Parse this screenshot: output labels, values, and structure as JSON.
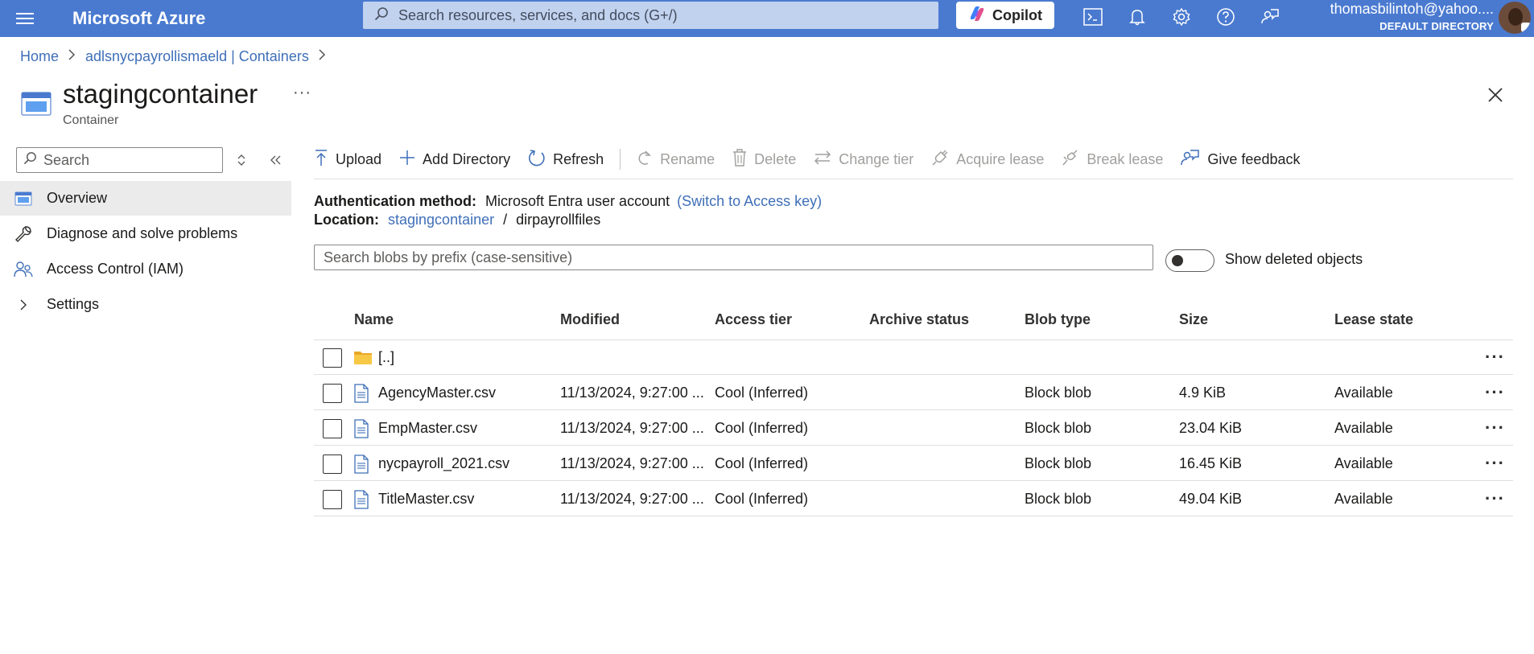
{
  "topbar": {
    "brand": "Microsoft Azure",
    "search_placeholder": "Search resources, services, and docs (G+/)",
    "copilot_label": "Copilot",
    "account_email": "thomasbilintoh@yahoo....",
    "account_directory": "DEFAULT DIRECTORY",
    "accent_color": "#4a7ad0"
  },
  "breadcrumb": {
    "home": "Home",
    "parent": "adlsnycpayrollismaeld | Containers"
  },
  "header": {
    "title": "stagingcontainer",
    "subtitle": "Container",
    "more": "···"
  },
  "nav": {
    "search_placeholder": "Search",
    "items": [
      {
        "label": "Overview",
        "icon": "container-icon"
      },
      {
        "label": "Diagnose and solve problems",
        "icon": "wrench-icon"
      },
      {
        "label": "Access Control (IAM)",
        "icon": "people-icon"
      },
      {
        "label": "Settings",
        "icon": "chevron-right-icon"
      }
    ]
  },
  "toolbar": {
    "upload": "Upload",
    "add_directory": "Add Directory",
    "refresh": "Refresh",
    "rename": "Rename",
    "delete": "Delete",
    "change_tier": "Change tier",
    "acquire_lease": "Acquire lease",
    "break_lease": "Break lease",
    "give_feedback": "Give feedback"
  },
  "info": {
    "auth_label": "Authentication method:",
    "auth_value": "Microsoft Entra user account",
    "auth_switch": "(Switch to Access key)",
    "location_label": "Location:",
    "location_container": "stagingcontainer",
    "location_sep": "/",
    "location_dir": "dirpayrollfiles"
  },
  "blob_search": {
    "placeholder": "Search blobs by prefix (case-sensitive)",
    "toggle_label": "Show deleted objects"
  },
  "table": {
    "columns": [
      "Name",
      "Modified",
      "Access tier",
      "Archive status",
      "Blob type",
      "Size",
      "Lease state"
    ],
    "rows": [
      {
        "name": "[..]",
        "type": "folder",
        "modified": "",
        "tier": "",
        "archive": "",
        "blob_type": "",
        "size": "",
        "lease": ""
      },
      {
        "name": "AgencyMaster.csv",
        "type": "file",
        "modified": "11/13/2024, 9:27:00 ...",
        "tier": "Cool (Inferred)",
        "archive": "",
        "blob_type": "Block blob",
        "size": "4.9 KiB",
        "lease": "Available"
      },
      {
        "name": "EmpMaster.csv",
        "type": "file",
        "modified": "11/13/2024, 9:27:00 ...",
        "tier": "Cool (Inferred)",
        "archive": "",
        "blob_type": "Block blob",
        "size": "23.04 KiB",
        "lease": "Available"
      },
      {
        "name": "nycpayroll_2021.csv",
        "type": "file",
        "modified": "11/13/2024, 9:27:00 ...",
        "tier": "Cool (Inferred)",
        "archive": "",
        "blob_type": "Block blob",
        "size": "16.45 KiB",
        "lease": "Available"
      },
      {
        "name": "TitleMaster.csv",
        "type": "file",
        "modified": "11/13/2024, 9:27:00 ...",
        "tier": "Cool (Inferred)",
        "archive": "",
        "blob_type": "Block blob",
        "size": "49.04 KiB",
        "lease": "Available"
      }
    ],
    "row_more": "···"
  }
}
